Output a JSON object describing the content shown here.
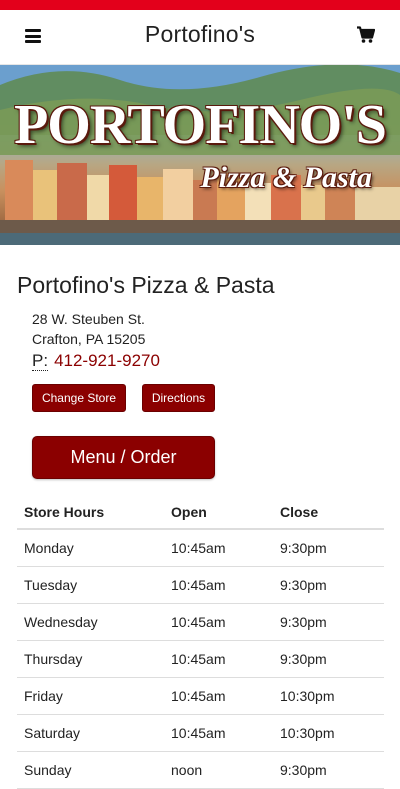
{
  "header": {
    "title": "Portofino's",
    "menu_icon": "hamburger-menu-icon",
    "cart_icon": "shopping-cart-icon",
    "accent_color": "#e3001b"
  },
  "banner": {
    "title": "PORTOFINO'S",
    "subtitle": "Pizza & Pasta"
  },
  "store": {
    "name": "Portofino's Pizza & Pasta",
    "address_line1": "28 W. Steuben St.",
    "address_line2": "Crafton, PA 15205",
    "phone_label": "P:",
    "phone": "412-921-9270"
  },
  "buttons": {
    "change_store": "Change Store",
    "directions": "Directions",
    "menu_order": "Menu / Order",
    "color": "#8b0000"
  },
  "hours": {
    "headers": [
      "Store Hours",
      "Open",
      "Close"
    ],
    "rows": [
      [
        "Monday",
        "10:45am",
        "9:30pm"
      ],
      [
        "Tuesday",
        "10:45am",
        "9:30pm"
      ],
      [
        "Wednesday",
        "10:45am",
        "9:30pm"
      ],
      [
        "Thursday",
        "10:45am",
        "9:30pm"
      ],
      [
        "Friday",
        "10:45am",
        "10:30pm"
      ],
      [
        "Saturday",
        "10:45am",
        "10:30pm"
      ],
      [
        "Sunday",
        "noon",
        "9:30pm"
      ]
    ]
  }
}
